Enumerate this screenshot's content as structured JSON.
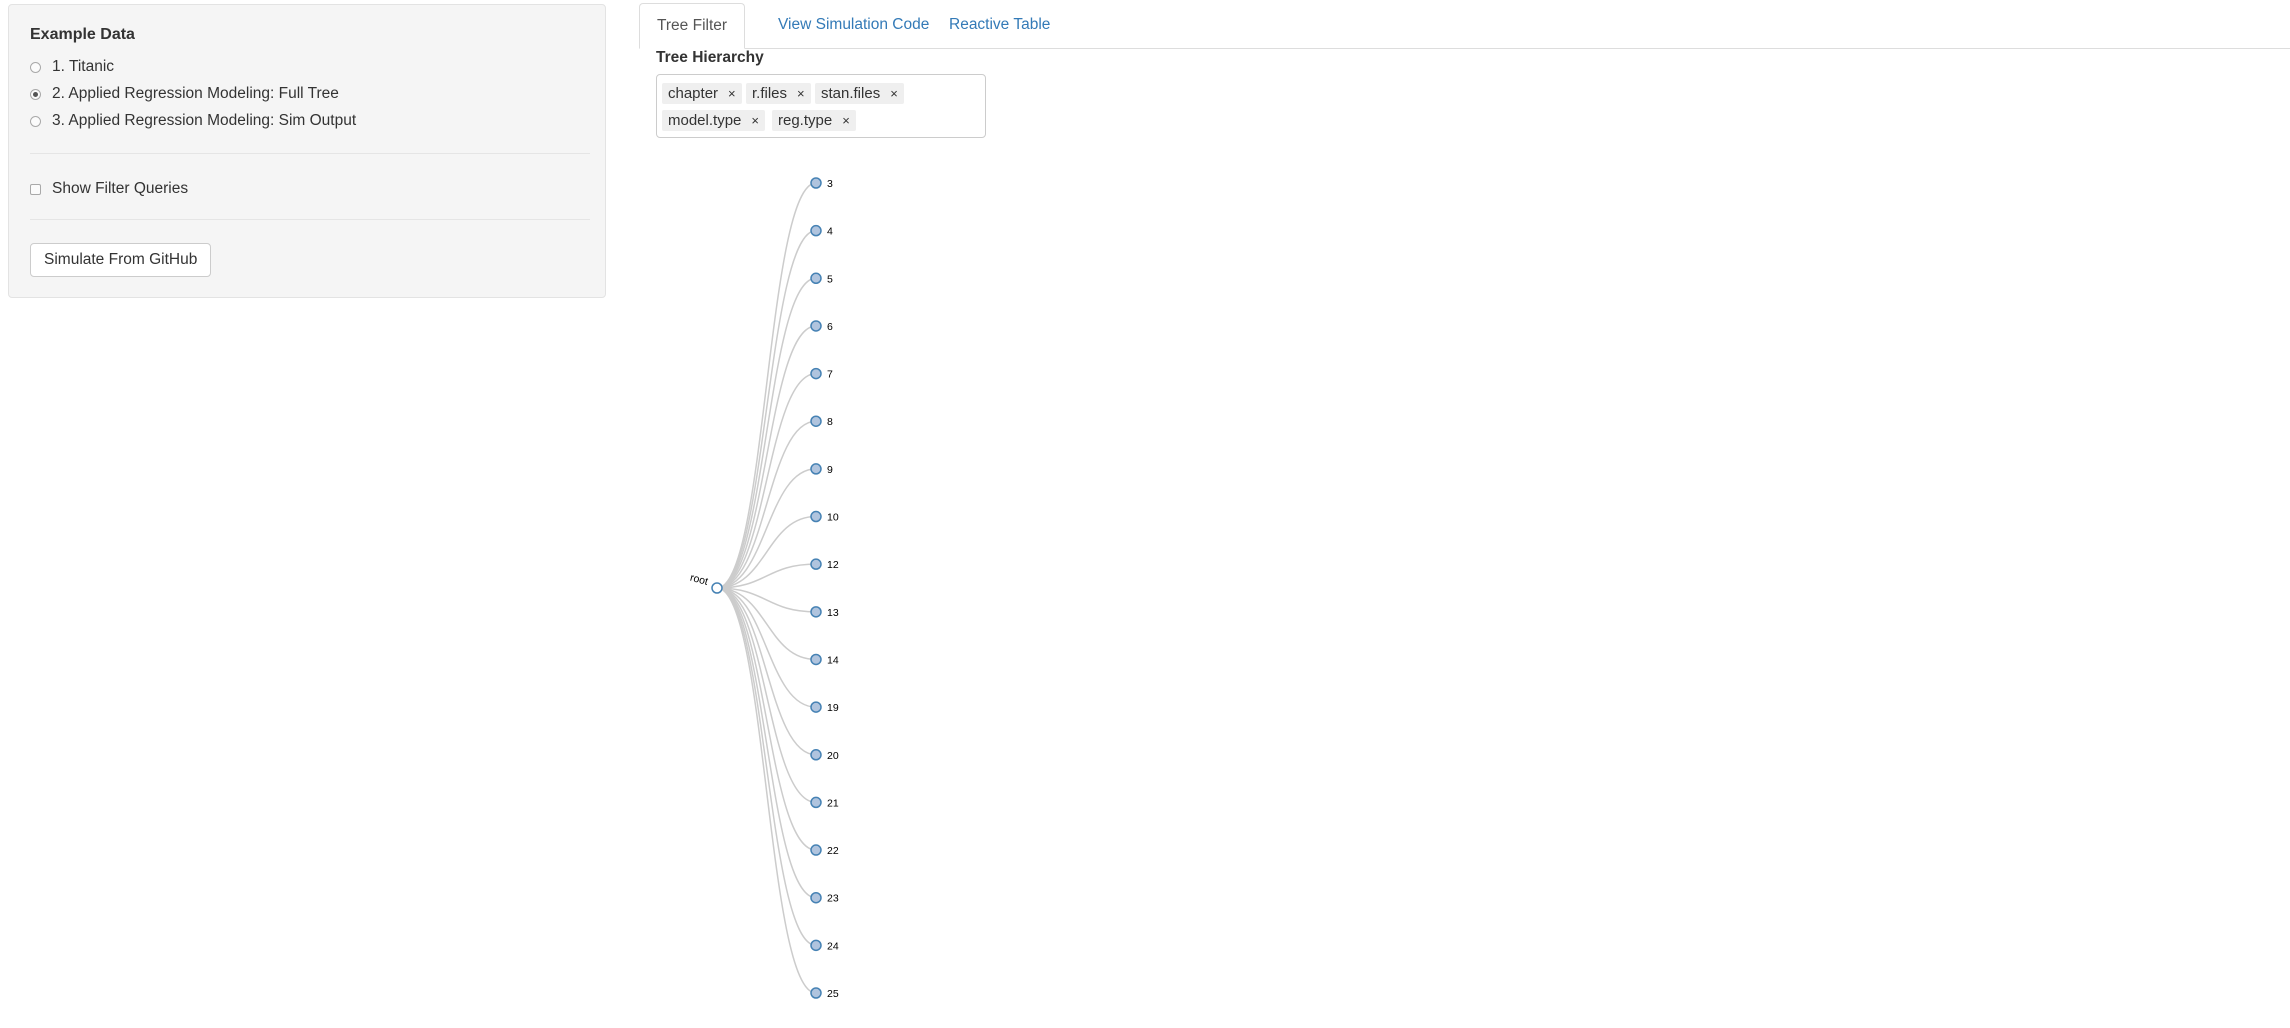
{
  "sidebar": {
    "heading": "Example Data",
    "radios": [
      {
        "label": "1. Titanic",
        "checked": false
      },
      {
        "label": "2. Applied Regression Modeling: Full Tree",
        "checked": true
      },
      {
        "label": "3. Applied Regression Modeling: Sim Output",
        "checked": false
      }
    ],
    "show_filter_queries_label": "Show Filter Queries",
    "show_filter_queries_checked": false,
    "simulate_button_label": "Simulate From GitHub"
  },
  "tabs": [
    {
      "label": "Tree Filter",
      "active": true
    },
    {
      "label": "View Simulation Code",
      "active": false
    },
    {
      "label": "Reactive Table",
      "active": false
    }
  ],
  "tree_hierarchy": {
    "label": "Tree Hierarchy",
    "chips": [
      "chapter",
      "r.files",
      "stan.files",
      "model.type",
      "reg.type"
    ],
    "remove_glyph": "×"
  },
  "tree": {
    "root_label": "root",
    "children": [
      "3",
      "4",
      "5",
      "6",
      "7",
      "8",
      "9",
      "10",
      "12",
      "13",
      "14",
      "19",
      "20",
      "21",
      "22",
      "23",
      "24",
      "25"
    ],
    "colors": {
      "link": "#cccccc",
      "node_fill": "#b0c4de",
      "node_stroke": "#4682b4"
    }
  }
}
